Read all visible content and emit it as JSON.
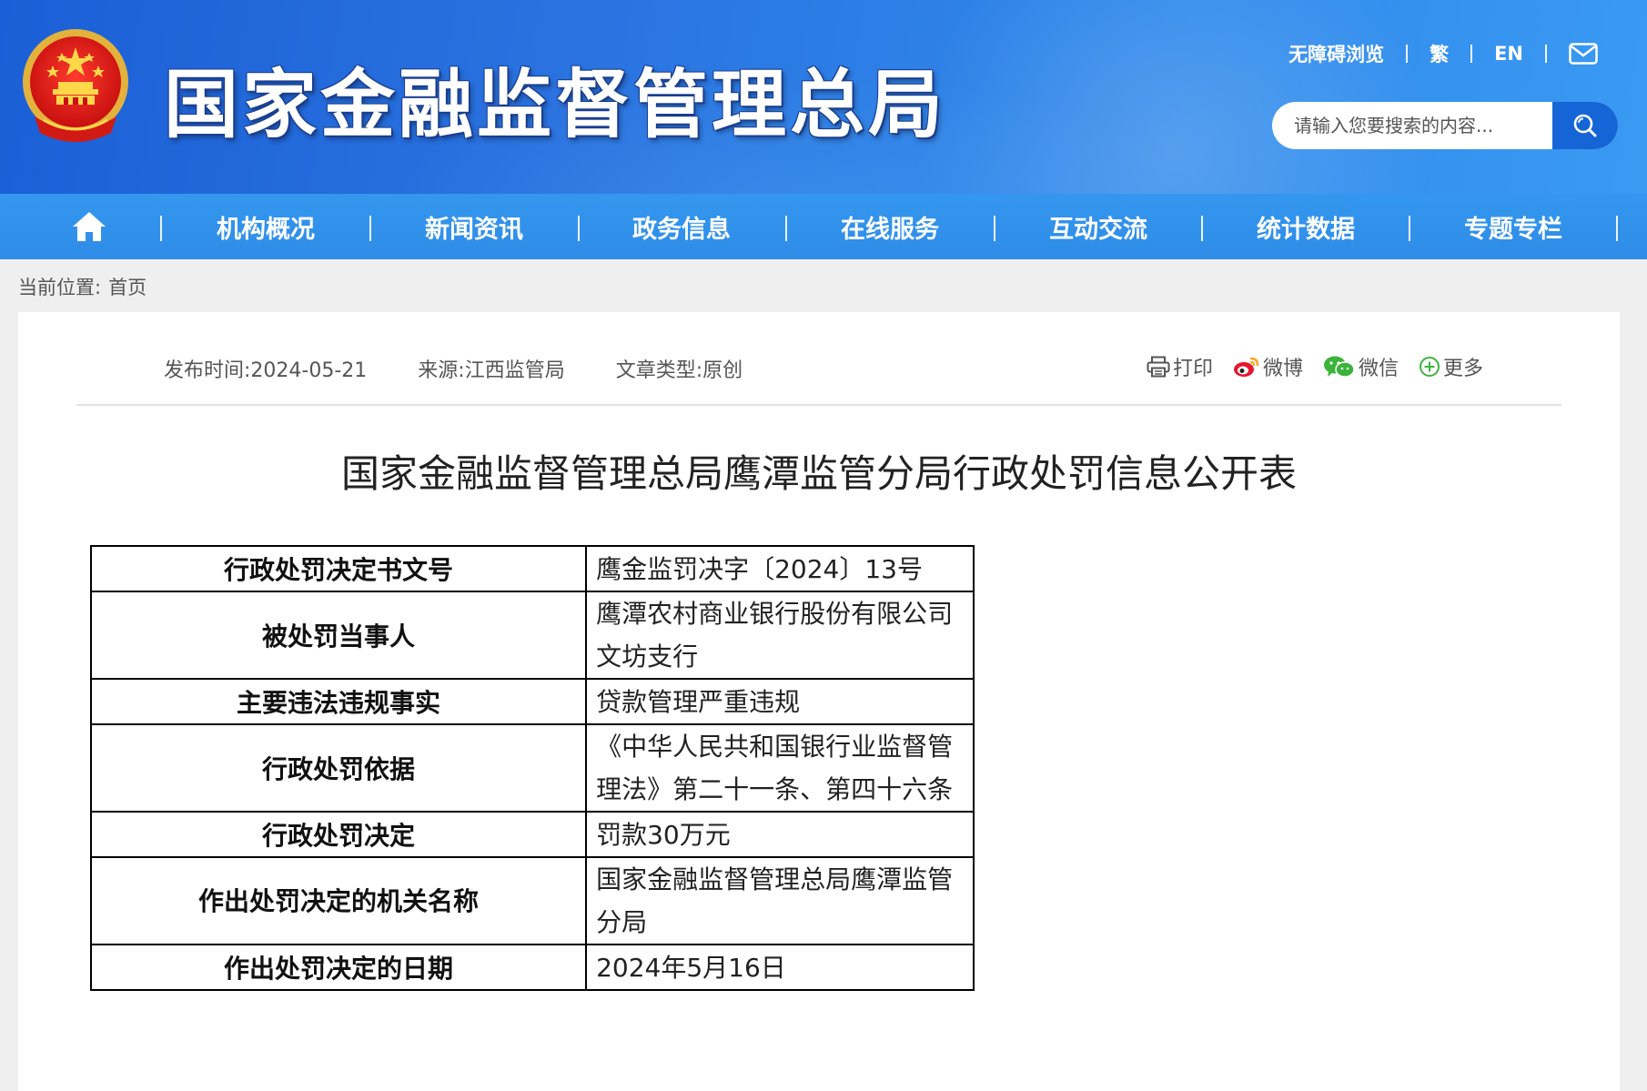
{
  "site": {
    "title": "国家金融监督管理总局",
    "top_links": {
      "accessible": "无障碍浏览",
      "traditional": "繁",
      "english": "EN"
    },
    "search_placeholder": "请输入您要搜索的内容..."
  },
  "nav": {
    "items": [
      "机构概况",
      "新闻资讯",
      "政务信息",
      "在线服务",
      "互动交流",
      "统计数据",
      "专题专栏"
    ]
  },
  "breadcrumb": {
    "label": "当前位置:",
    "home": "首页"
  },
  "article": {
    "meta": {
      "publish": "发布时间:2024-05-21",
      "source": "来源:江西监管局",
      "type": "文章类型:原创"
    },
    "share": {
      "print": "打印",
      "weibo": "微博",
      "wechat": "微信",
      "more": "更多"
    },
    "title": "国家金融监督管理总局鹰潭监管分局行政处罚信息公开表",
    "table": [
      {
        "key": "行政处罚决定书文号",
        "value": "鹰金监罚决字〔2024〕13号"
      },
      {
        "key": "被处罚当事人",
        "value": "鹰潭农村商业银行股份有限公司文坊支行"
      },
      {
        "key": "主要违法违规事实",
        "value": "贷款管理严重违规"
      },
      {
        "key": "行政处罚依据",
        "value": "《中华人民共和国银行业监督管理法》第二十一条、第四十六条"
      },
      {
        "key": "行政处罚决定",
        "value": "罚款30万元"
      },
      {
        "key": "作出处罚决定的机关名称",
        "value": "国家金融监督管理总局鹰潭监管分局"
      },
      {
        "key": "作出处罚决定的日期",
        "value": "2024年5月16日"
      }
    ]
  },
  "colors": {
    "header": "#2a73e0",
    "nav": "#3191eb",
    "search_button": "#1565d6"
  },
  "icons": [
    "national-emblem-icon",
    "mail-icon",
    "search-icon",
    "home-icon",
    "print-icon",
    "weibo-icon",
    "wechat-icon",
    "plus-circle-icon"
  ]
}
